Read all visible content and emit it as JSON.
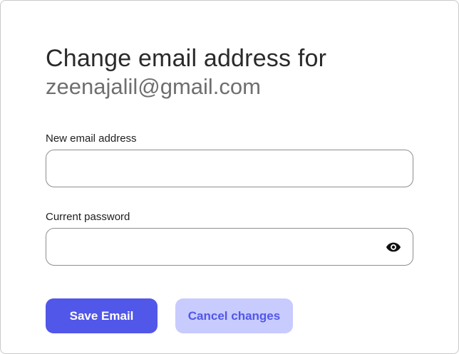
{
  "dialog": {
    "title": "Change email address for",
    "current_email": "zeenajalil@gmail.com"
  },
  "form": {
    "new_email": {
      "label": "New email address",
      "value": "",
      "placeholder": ""
    },
    "current_password": {
      "label": "Current password",
      "value": "",
      "placeholder": "",
      "toggle_icon": "eye-icon"
    }
  },
  "actions": {
    "save_label": "Save Email",
    "cancel_label": "Cancel changes"
  },
  "colors": {
    "primary": "#5157e8",
    "secondary_bg": "#c8cbfd",
    "title_text": "#2a2a2a",
    "email_text": "#6f6f6f",
    "input_border": "#8e8e8e"
  }
}
